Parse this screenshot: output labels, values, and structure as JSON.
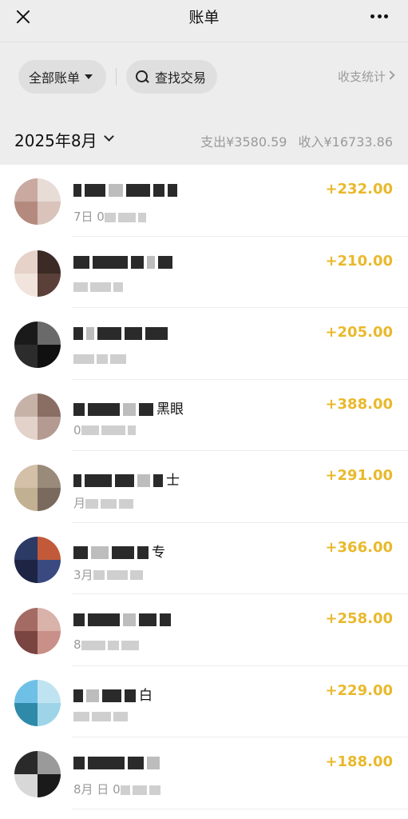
{
  "header": {
    "title": "账单"
  },
  "filters": {
    "all_bills_label": "全部账单",
    "search_label": "查找交易",
    "stats_label": "收支统计"
  },
  "month_bar": {
    "month": "2025年8月",
    "expense": "支出¥3580.59",
    "income": "收入¥16733.86"
  },
  "colors": {
    "amount": "#e9b92c",
    "background": "#ededed"
  },
  "transactions": [
    {
      "name": "",
      "sub": "7日 0",
      "amount": "+232.00",
      "avatar": [
        "#c9a9a0",
        "#e8dcd6",
        "#b58a7e",
        "#d9c3bb"
      ]
    },
    {
      "name": "",
      "sub": "",
      "amount": "+210.00",
      "avatar": [
        "#e6d2c8",
        "#3b2a26",
        "#f0e4dc",
        "#5a4038"
      ]
    },
    {
      "name": "",
      "sub": "",
      "amount": "+205.00",
      "avatar": [
        "#1a1a1a",
        "#6a6a6a",
        "#2c2c2c",
        "#101010"
      ]
    },
    {
      "name": "黑眼",
      "sub": "0",
      "amount": "+388.00",
      "avatar": [
        "#c7b2a8",
        "#8a6e64",
        "#e2d2ca",
        "#b49a90"
      ]
    },
    {
      "name": "士",
      "sub": "月",
      "amount": "+291.00",
      "avatar": [
        "#d4c0a8",
        "#9a8a7a",
        "#c2b092",
        "#7a6a5e"
      ]
    },
    {
      "name": "专",
      "sub": "3月",
      "amount": "+366.00",
      "avatar": [
        "#2c3a66",
        "#c25a3a",
        "#1e2444",
        "#3a4a80"
      ]
    },
    {
      "name": "",
      "sub": "8",
      "amount": "+258.00",
      "avatar": [
        "#a46a64",
        "#d9b2aa",
        "#7a4440",
        "#c89088"
      ]
    },
    {
      "name": "白",
      "sub": "",
      "amount": "+229.00",
      "avatar": [
        "#6ec0e6",
        "#bfe3f1",
        "#2e8aa8",
        "#9ed4e8"
      ]
    },
    {
      "name": "",
      "sub": "8月 日 0",
      "amount": "+188.00",
      "avatar": [
        "#2a2a2a",
        "#9a9a9a",
        "#d8d8d8",
        "#1a1a1a"
      ]
    }
  ]
}
